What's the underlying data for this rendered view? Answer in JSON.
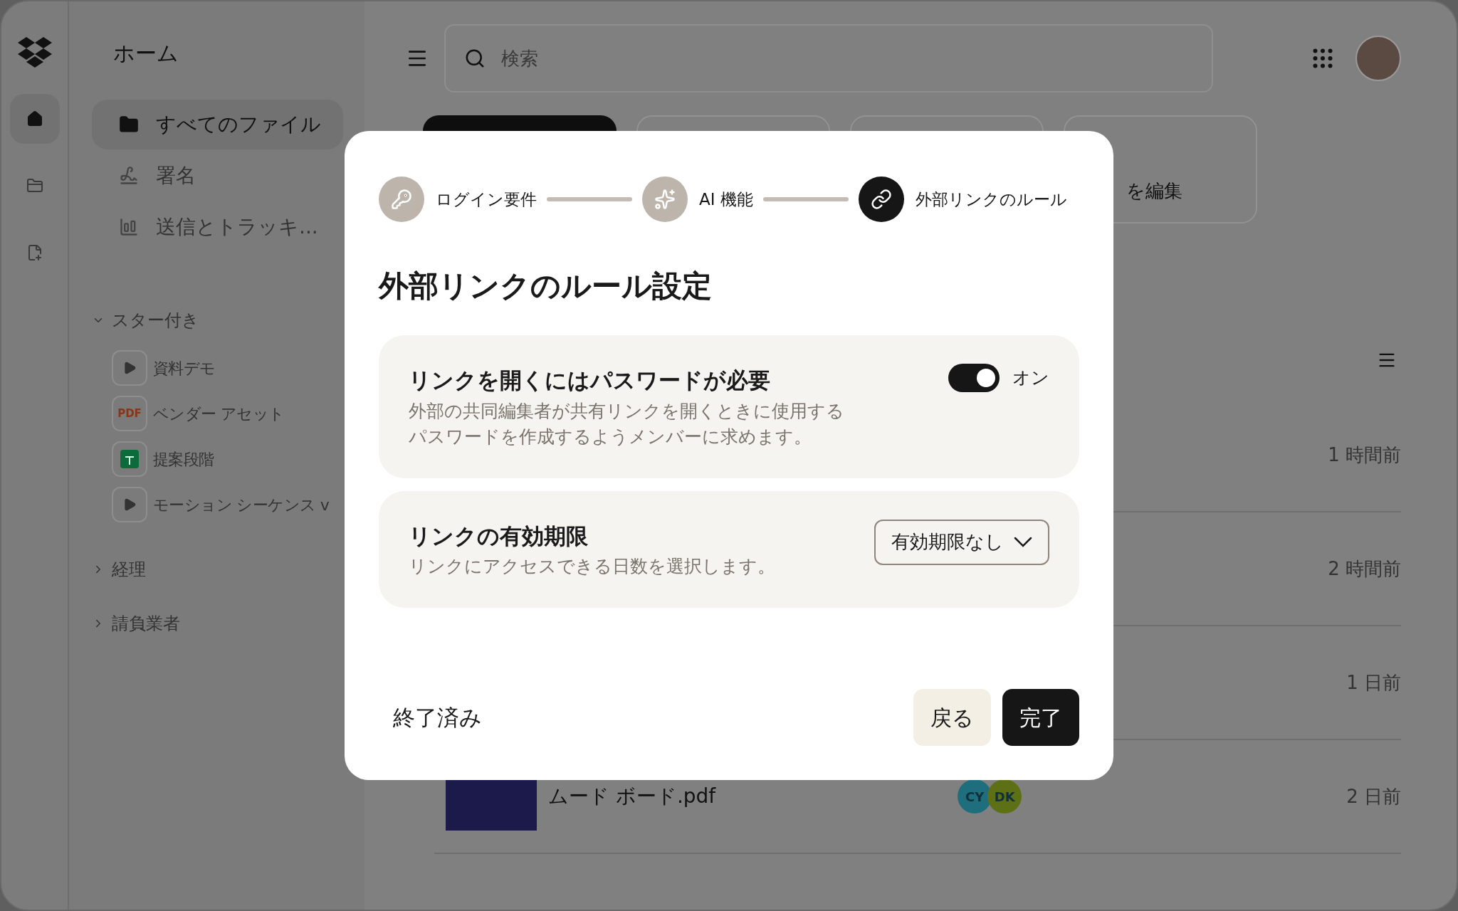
{
  "rail": {
    "items": [
      {
        "kind": "home",
        "selected": true
      },
      {
        "kind": "folder",
        "selected": false
      },
      {
        "kind": "page",
        "selected": false
      }
    ]
  },
  "sidebar": {
    "title": "ホーム",
    "nav": [
      {
        "kind": "folder",
        "label": "すべてのファイル",
        "selected": true
      },
      {
        "kind": "signature",
        "label": "署名",
        "selected": false
      },
      {
        "kind": "chart",
        "label": "送信とトラッキ...",
        "selected": false
      }
    ],
    "starred": {
      "label": "スター付き",
      "expanded": true,
      "items": [
        {
          "kind": "video",
          "name": "資料デモ"
        },
        {
          "kind": "pdf",
          "badge": "PDF",
          "name": "ベンダー アセット"
        },
        {
          "kind": "sheet",
          "name": "提案段階"
        },
        {
          "kind": "video",
          "name": "モーション シーケンス v"
        }
      ]
    },
    "folders": [
      {
        "label": "経理",
        "expanded": false
      },
      {
        "label": "請負業者",
        "expanded": false
      }
    ]
  },
  "search": {
    "placeholder": "検索"
  },
  "cards": [
    {
      "kind": "primary"
    },
    {
      "kind": "outline"
    },
    {
      "kind": "outline"
    },
    {
      "kind": "outline",
      "label": "を編集"
    }
  ],
  "files": [
    {
      "time": "1 時間前"
    },
    {
      "time": "2 時間前"
    },
    {
      "time": "1 日前"
    },
    {
      "name": "ムード ボード.pdf",
      "time": "2 日前",
      "collaborators": [
        {
          "initials": "CY",
          "color": "#1e6e7e"
        },
        {
          "initials": "DK",
          "color": "#5e7016"
        }
      ]
    }
  ],
  "dialog": {
    "steps": [
      {
        "kind": "key",
        "label": "ログイン要件",
        "active": false
      },
      {
        "kind": "ai",
        "label": "AI 機能",
        "active": false
      },
      {
        "kind": "link",
        "label": "外部リンクのルール",
        "active": true
      }
    ],
    "title": "外部リンクのルール設定",
    "settings": [
      {
        "kind": "toggle",
        "title": "リンクを開くにはパスワードが必要",
        "description": "外部の共同編集者が共有リンクを開くときに使用するパスワードを作成するようメンバーに求めます。",
        "on": true,
        "state_label": "オン"
      },
      {
        "kind": "dropdown",
        "title": "リンクの有効期限",
        "description": "リンクにアクセスできる日数を選択します。",
        "value": "有効期限なし"
      }
    ],
    "footer": {
      "skip": "終了済み",
      "back": "戻る",
      "done": "完了"
    }
  }
}
